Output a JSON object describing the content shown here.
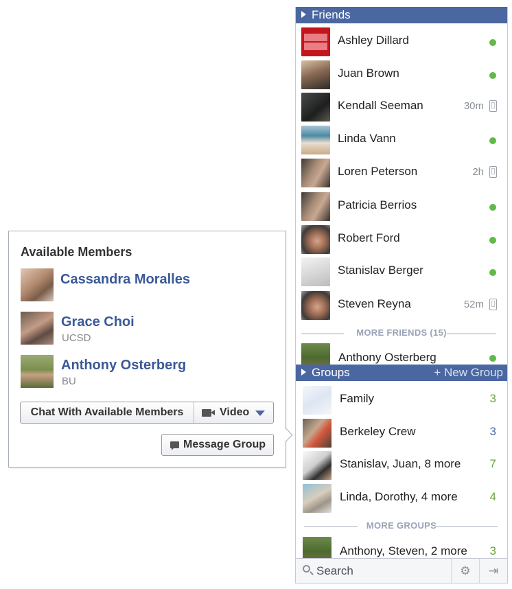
{
  "sidebar": {
    "friends_header": "Friends",
    "friends": [
      {
        "name": "Ashley Dillard",
        "status": "online"
      },
      {
        "name": "Juan Brown",
        "status": "online"
      },
      {
        "name": "Kendall Seeman",
        "status": "mobile",
        "time": "30m"
      },
      {
        "name": "Linda Vann",
        "status": "online"
      },
      {
        "name": "Loren Peterson",
        "status": "mobile",
        "time": "2h"
      },
      {
        "name": "Patricia Berrios",
        "status": "online"
      },
      {
        "name": "Robert Ford",
        "status": "online"
      },
      {
        "name": "Stanislav Berger",
        "status": "online"
      },
      {
        "name": "Steven Reyna",
        "status": "mobile",
        "time": "52m"
      }
    ],
    "more_friends_label": "MORE FRIENDS (15)",
    "extra_friend": {
      "name": "Anthony Osterberg",
      "status": "online"
    },
    "groups_header": "Groups",
    "new_group_label": "+ New Group",
    "groups": [
      {
        "name": "Family",
        "count": "3"
      },
      {
        "name": "Berkeley Crew",
        "count": "3"
      },
      {
        "name": "Stanislav, Juan, 8 more",
        "count": "7"
      },
      {
        "name": "Linda, Dorothy, 4 more",
        "count": "4"
      }
    ],
    "more_groups_label": "MORE GROUPS",
    "extra_group": {
      "name": "Anthony, Steven, 2 more",
      "count": "3"
    },
    "search_label": "Search"
  },
  "flyout": {
    "title": "Available Members",
    "members": [
      {
        "name": "Cassandra Moralles",
        "sub": ""
      },
      {
        "name": "Grace Choi",
        "sub": "UCSD"
      },
      {
        "name": "Anthony Osterberg",
        "sub": "BU"
      }
    ],
    "chat_button": "Chat With Available Members",
    "video_button": "Video",
    "message_button": "Message Group"
  },
  "colors": {
    "header_blue": "#4b67a1",
    "link_blue": "#3b5998",
    "online_green": "#63b84a",
    "count_green": "#6ca33c"
  }
}
